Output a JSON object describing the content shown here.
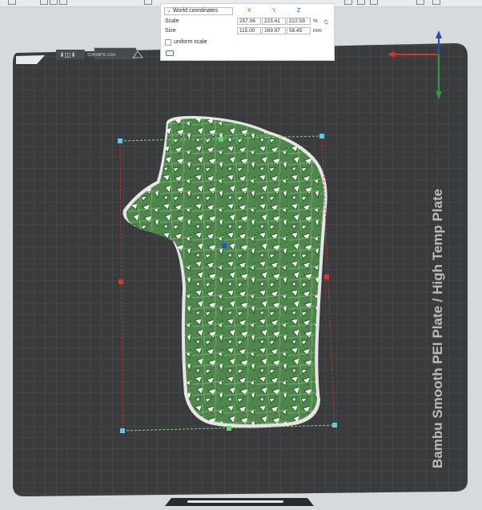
{
  "scale_panel": {
    "coordinate_system": "World coordinates",
    "axes": [
      "X",
      "Y",
      "Z"
    ],
    "scale_label": "Scale",
    "size_label": "Size",
    "scale_values": [
      "257.06",
      "223.41",
      "222.59"
    ],
    "scale_unit": "%",
    "size_values": [
      "115.00",
      "169.97",
      "58.45"
    ],
    "size_unit": "mm",
    "uniform_scale_label": "uniform scale",
    "uniform_scale_checked": false
  },
  "plate": {
    "vertical_label": "Bambu Smooth PEI Plate / High Temp Plate",
    "corner_label": "HOT SURFACE",
    "corner_icon": "warning-triangle-icon"
  },
  "colors": {
    "model": "#4f8a4c",
    "plate": "#3c3d3f",
    "grid": "#5a5c5f",
    "bounding_box": "#d9332a",
    "handle": "#3fc4d9",
    "axis_x": "#d9332a",
    "axis_y": "#2f9a3c",
    "axis_z": "#2050c0"
  }
}
